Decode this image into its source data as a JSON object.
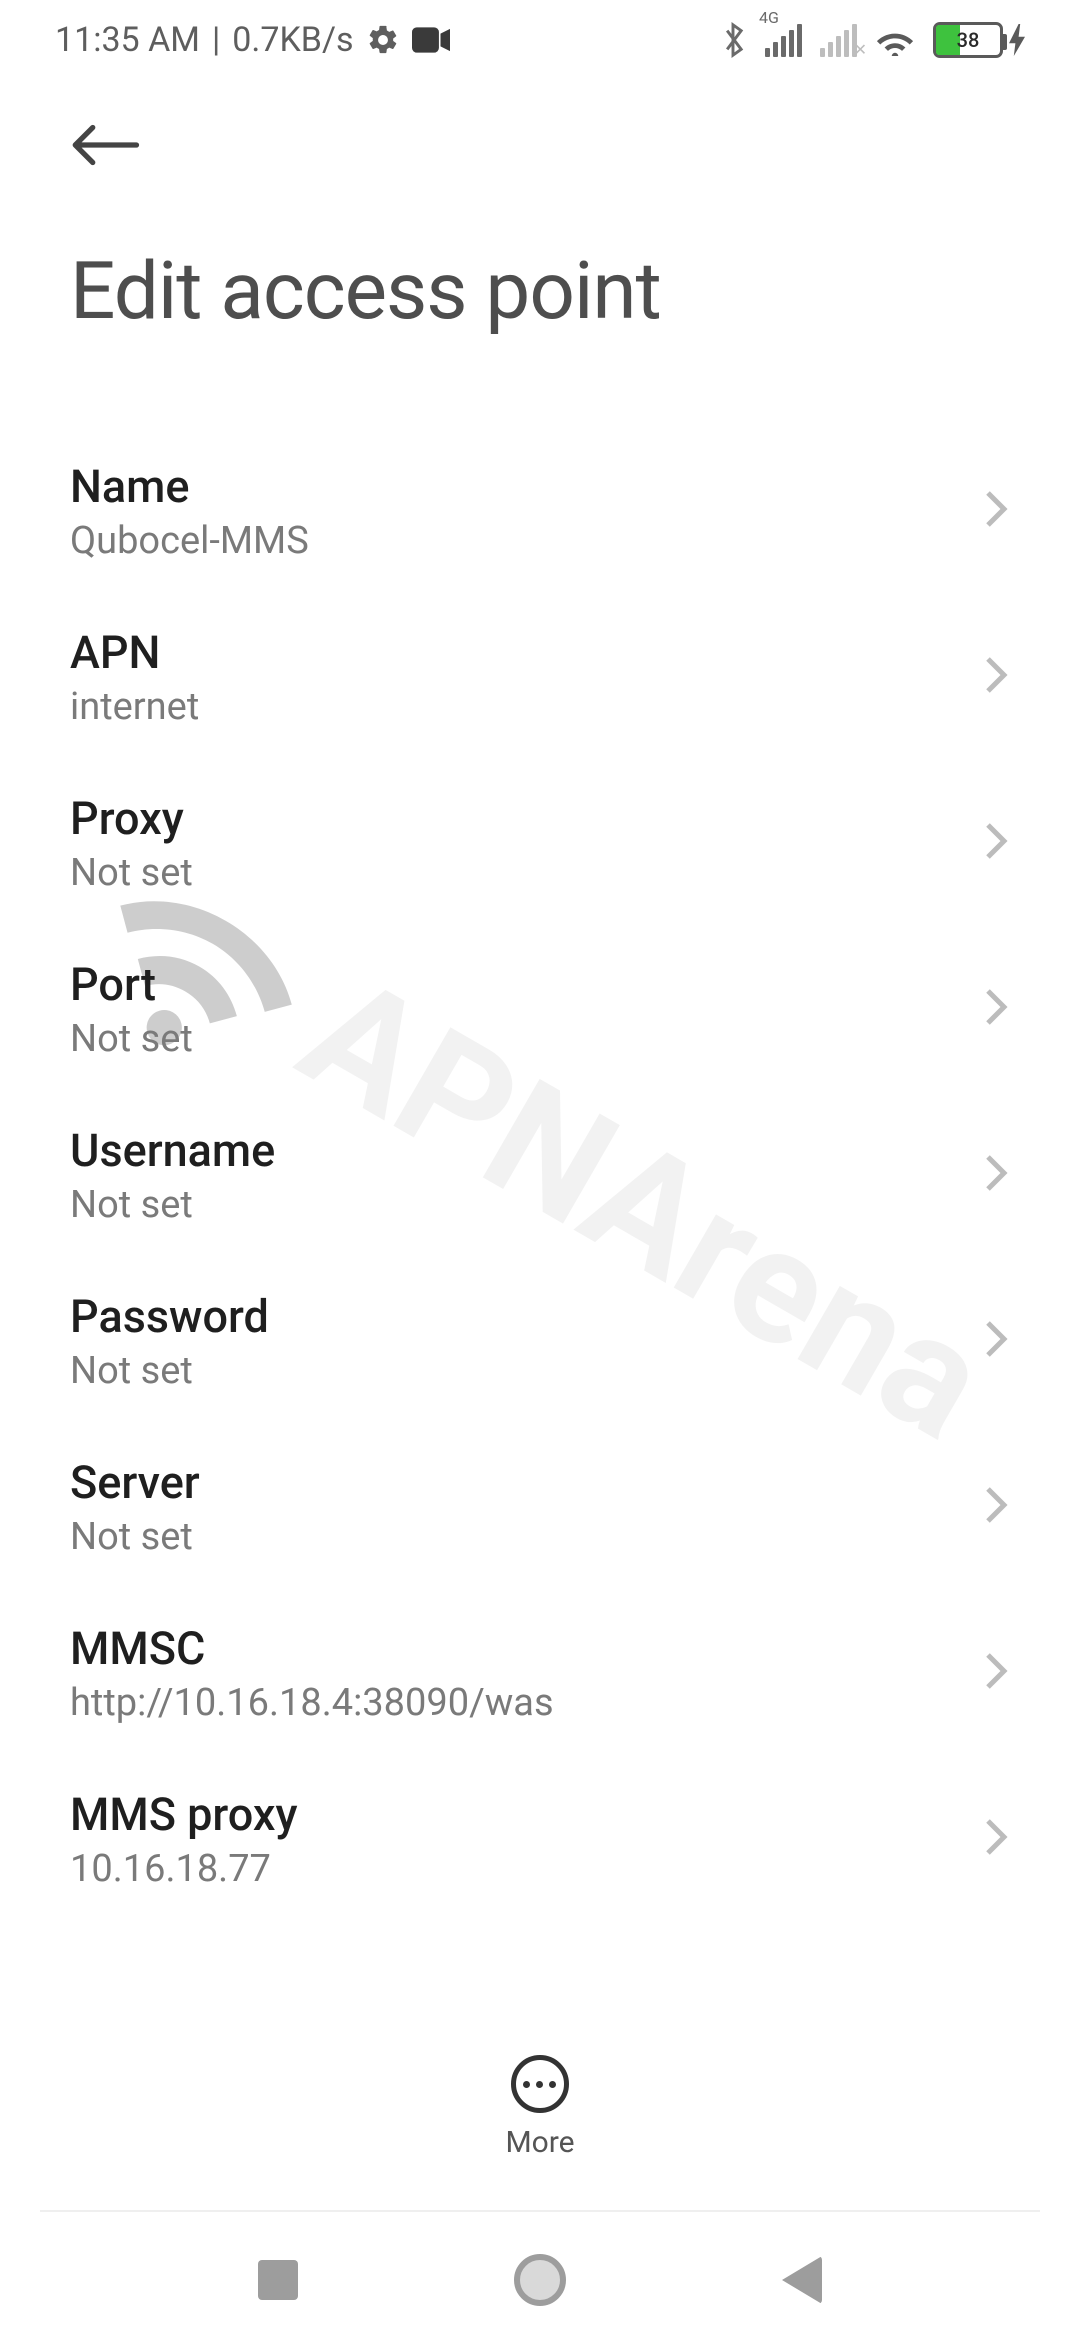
{
  "status": {
    "time": "11:35 AM",
    "rate": "0.7KB/s",
    "net_label": "4G",
    "battery_pct": 38
  },
  "header": {
    "title": "Edit access point"
  },
  "fields": [
    {
      "label": "Name",
      "value": "Qubocel-MMS"
    },
    {
      "label": "APN",
      "value": "internet"
    },
    {
      "label": "Proxy",
      "value": "Not set"
    },
    {
      "label": "Port",
      "value": "Not set"
    },
    {
      "label": "Username",
      "value": "Not set"
    },
    {
      "label": "Password",
      "value": "Not set"
    },
    {
      "label": "Server",
      "value": "Not set"
    },
    {
      "label": "MMSC",
      "value": "http://10.16.18.4:38090/was"
    },
    {
      "label": "MMS proxy",
      "value": "10.16.18.77"
    }
  ],
  "toolbar": {
    "more_label": "More"
  },
  "watermark": "APNArena"
}
